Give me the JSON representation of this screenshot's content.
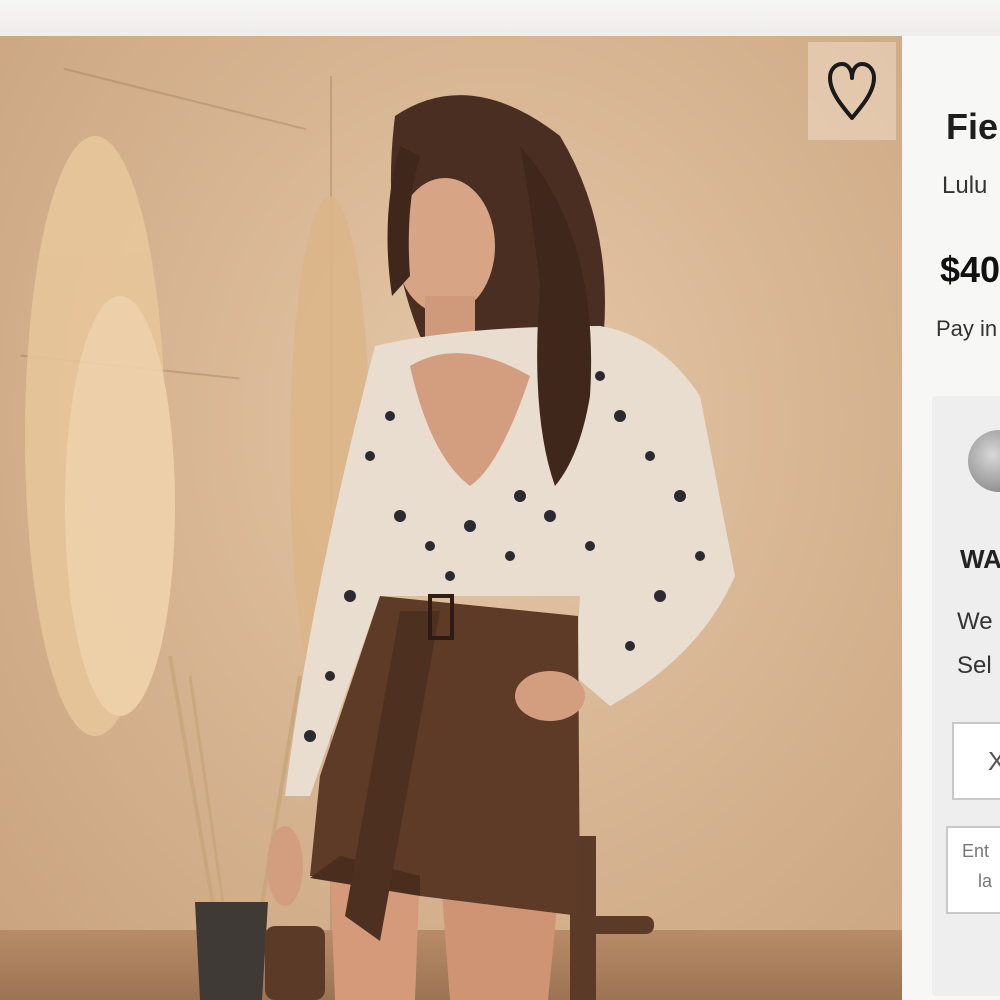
{
  "product": {
    "title": "Fie",
    "brand": "Lulu",
    "price": "$40",
    "pay_in": "Pay in"
  },
  "wishlist": {
    "icon": "heart-icon"
  },
  "promo": {
    "heading": "WA",
    "line1": "We",
    "line2": "Sel",
    "close_label": "X",
    "input_line1": "Ent",
    "input_line2": "la"
  },
  "colors": {
    "photo_background": "#d8b693",
    "panel_background": "#f7f7f6",
    "promo_background": "#eeeeee",
    "text_dark": "#1e1e1e"
  }
}
